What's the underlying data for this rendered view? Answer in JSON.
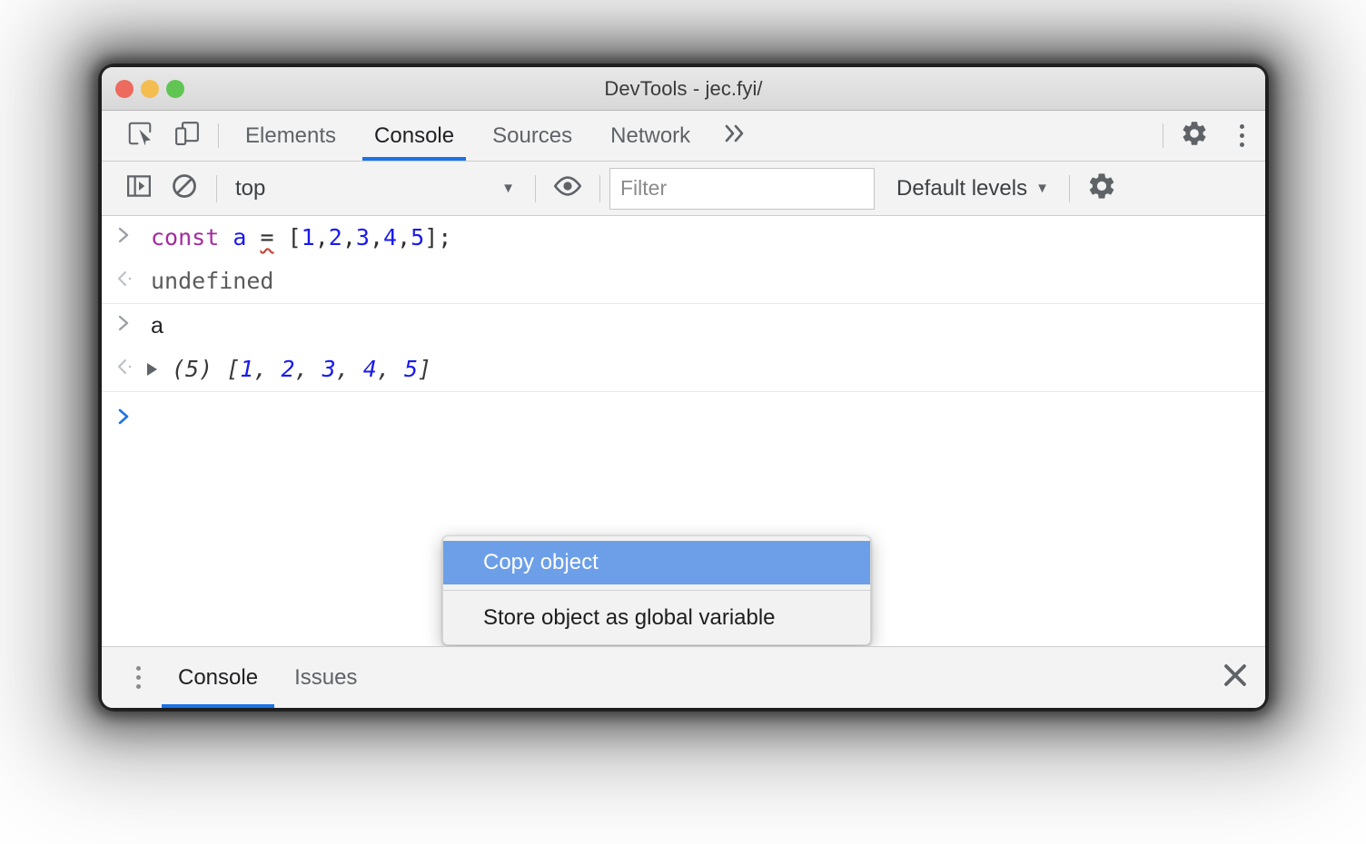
{
  "window": {
    "title": "DevTools - jec.fyi/",
    "traffic_lights": [
      {
        "name": "close",
        "color": "#ec6a5e"
      },
      {
        "name": "minimize",
        "color": "#f4bd4f"
      },
      {
        "name": "maximize",
        "color": "#61c554"
      }
    ]
  },
  "main_tabbar": {
    "icons": [
      {
        "name": "inspect-element-icon"
      },
      {
        "name": "device-toolbar-icon"
      }
    ],
    "tabs": [
      {
        "label": "Elements",
        "active": false
      },
      {
        "label": "Console",
        "active": true
      },
      {
        "label": "Sources",
        "active": false
      },
      {
        "label": "Network",
        "active": false
      }
    ],
    "more_tabs_label": "»",
    "settings_label": "Settings",
    "more_options_label": "More options"
  },
  "console_toolbar": {
    "sidebar_toggle_label": "Show console sidebar",
    "clear_console_label": "Clear console",
    "context": {
      "value": "top",
      "caret": "▼"
    },
    "live_expression_label": "Create live expression",
    "filter": {
      "value": "",
      "placeholder": "Filter"
    },
    "levels": {
      "label": "Default levels",
      "caret": "▼"
    },
    "settings_label": "Console settings"
  },
  "console": {
    "groups": [
      {
        "rows": [
          {
            "type": "input",
            "gutter": "›",
            "tokens": [
              {
                "text": "const",
                "kind": "keyword"
              },
              {
                "text": " ",
                "kind": "punct"
              },
              {
                "text": "a",
                "kind": "var"
              },
              {
                "text": " ",
                "kind": "punct"
              },
              {
                "text": "=",
                "kind": "eq"
              },
              {
                "text": " ",
                "kind": "punct"
              },
              {
                "text": "[",
                "kind": "punct"
              },
              {
                "text": "1",
                "kind": "num"
              },
              {
                "text": ",",
                "kind": "punct"
              },
              {
                "text": "2",
                "kind": "num"
              },
              {
                "text": ",",
                "kind": "punct"
              },
              {
                "text": "3",
                "kind": "num"
              },
              {
                "text": ",",
                "kind": "punct"
              },
              {
                "text": "4",
                "kind": "num"
              },
              {
                "text": ",",
                "kind": "punct"
              },
              {
                "text": "5",
                "kind": "num"
              },
              {
                "text": "];",
                "kind": "punct"
              }
            ]
          },
          {
            "type": "output",
            "gutter": "‹·",
            "text": "undefined"
          }
        ]
      },
      {
        "rows": [
          {
            "type": "input",
            "gutter": "›",
            "plain": "a"
          },
          {
            "type": "object",
            "gutter": "‹·",
            "count": "(5)",
            "open_bracket": "[",
            "values": [
              "1",
              "2",
              "3",
              "4",
              "5"
            ],
            "close_bracket": "]"
          }
        ]
      }
    ],
    "prompt": {
      "gutter": "›",
      "value": ""
    }
  },
  "context_menu": {
    "items": [
      {
        "label": "Copy object",
        "highlighted": true
      },
      {
        "label": "Store object as global variable",
        "highlighted": false
      }
    ],
    "highlight_color": "#6c9fe8"
  },
  "drawer": {
    "more_tools_label": "More tools",
    "tabs": [
      {
        "label": "Console",
        "active": true
      },
      {
        "label": "Issues",
        "active": false
      }
    ],
    "close_label": "Close drawer"
  },
  "colors": {
    "accent": "#1a73e8",
    "keyword": "#a52a9f",
    "number": "#1a1aee",
    "error_squiggle": "#c43b2f"
  }
}
